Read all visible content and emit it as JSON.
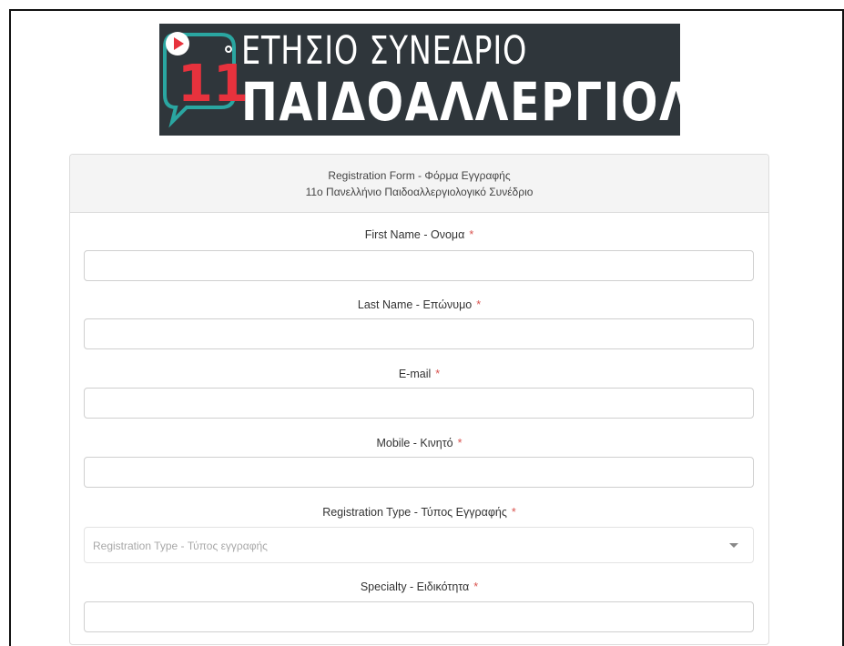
{
  "banner": {
    "number": "11",
    "degree": "°",
    "line1": "ΕΤΗΣΙΟ ΣΥΝΕΔΡΙΟ",
    "line2": "ΠΑΙΔΟΑΛΛΕΡΓΙΟΛΟΓΙΑΣ",
    "colors": {
      "background": "#2f363b",
      "teal": "#2aa6a1",
      "red": "#e7323d",
      "text": "#ffffff"
    }
  },
  "form": {
    "header_line1": "Registration Form - Φόρμα Εγγραφής",
    "header_line2": "11ο Πανελλήνιο Παιδοαλλεργιολογικό Συνέδριο",
    "required_mark": "*",
    "fields": [
      {
        "label": "First Name - Ονομα",
        "value": ""
      },
      {
        "label": "Last Name - Επώνυμο",
        "value": ""
      },
      {
        "label": "E-mail",
        "value": ""
      },
      {
        "label": "Mobile - Κινητό",
        "value": ""
      },
      {
        "label": "Registration Type - Τύπος Εγγραφής",
        "placeholder": "Registration Type - Τύπος εγγραφής"
      },
      {
        "label": "Specialty - Ειδικότητα",
        "value": ""
      }
    ]
  }
}
